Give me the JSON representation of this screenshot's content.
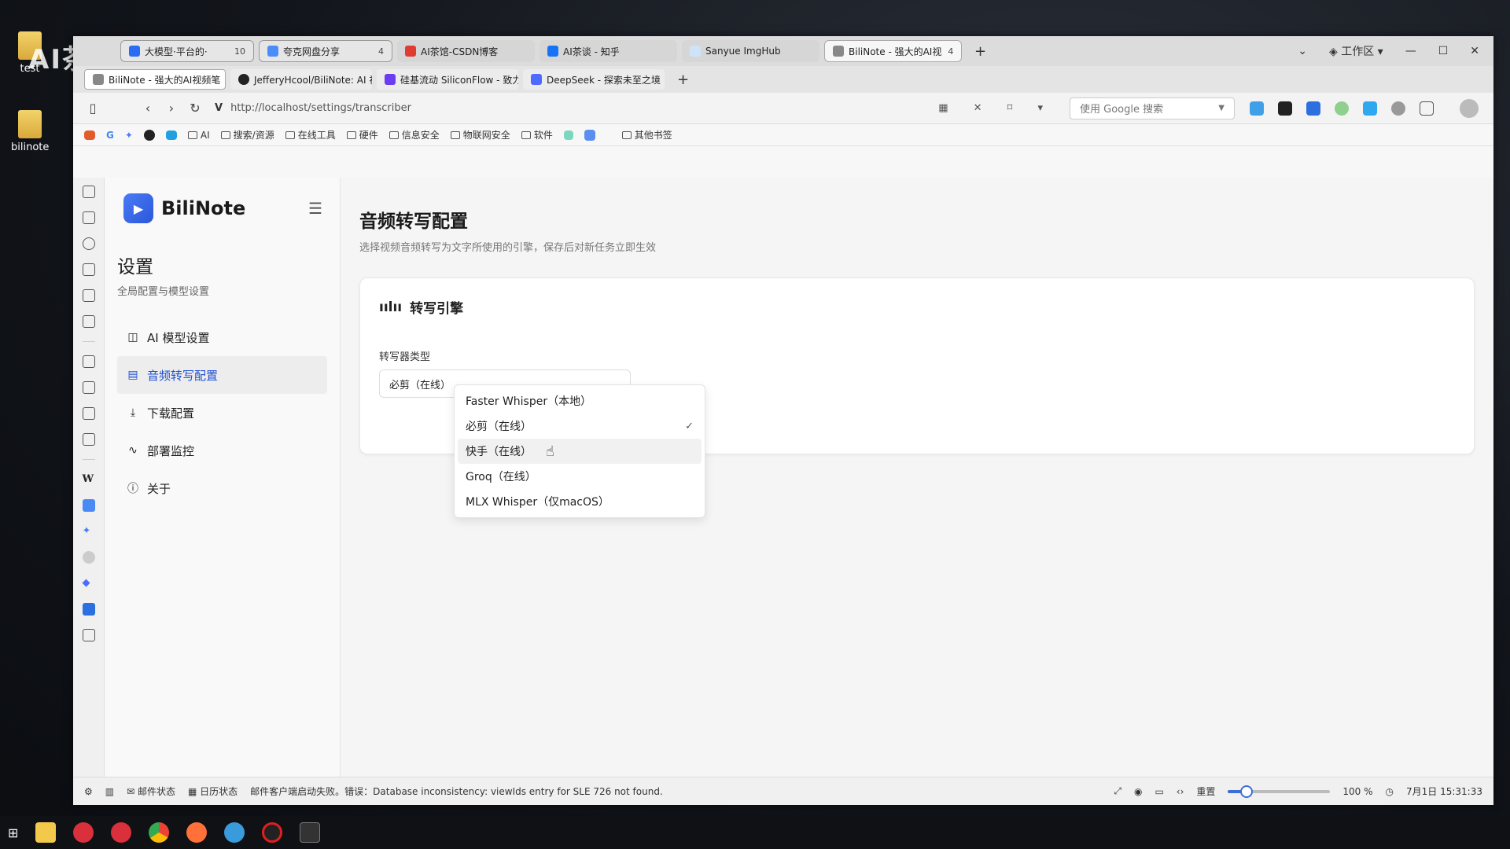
{
  "desktop": {
    "icons": [
      {
        "label": "test"
      },
      {
        "label": "bilinote"
      }
    ],
    "watermark": "AI茶谈"
  },
  "browser": {
    "tabs_row1": [
      {
        "title": "大模型·平台的·",
        "count": "10",
        "color": "#2a6df4"
      },
      {
        "title": "夸克网盘分享",
        "count": "4",
        "color": "#4b8df8"
      },
      {
        "title": "AI茶馆-CSDN博客",
        "count": "",
        "color": "#e03c31"
      },
      {
        "title": "AI茶谈 - 知乎",
        "count": "",
        "color": "#1772f6"
      },
      {
        "title": "Sanyue ImgHub",
        "count": "",
        "color": "#cfe3f7"
      },
      {
        "title": "BiliNote - 强大的AI视",
        "count": "4",
        "color": "#888888"
      }
    ],
    "workspace_label": "工作区",
    "tabs_row2": [
      {
        "title": "BiliNote - 强大的AI视频笔",
        "color": "#888888"
      },
      {
        "title": "JefferyHcool/BiliNote: AI 视",
        "color": "#222222"
      },
      {
        "title": "硅基流动 SiliconFlow - 致力",
        "color": "#6b3cf0"
      },
      {
        "title": "DeepSeek - 探索未至之境",
        "color": "#4d6bfe"
      }
    ],
    "url": "http://localhost/settings/transcriber",
    "search_placeholder": "使用 Google 搜索",
    "bookmarks": [
      "AI",
      "搜索/资源",
      "在线工具",
      "硬件",
      "信息安全",
      "物联网安全",
      "软件",
      "其他书签"
    ]
  },
  "app": {
    "name": "BiliNote",
    "settings_title": "设置",
    "settings_subtitle": "全局配置与模型设置",
    "menu": [
      {
        "label": "AI 模型设置",
        "icon": "bot-icon"
      },
      {
        "label": "音频转写配置",
        "icon": "transcribe-icon"
      },
      {
        "label": "下载配置",
        "icon": "download-icon"
      },
      {
        "label": "部署监控",
        "icon": "activity-icon"
      },
      {
        "label": "关于",
        "icon": "info-icon"
      }
    ],
    "page_title": "音频转写配置",
    "page_subtitle": "选择视频音频转写为文字所使用的引擎，保存后对新任务立即生效",
    "card_title": "转写引擎",
    "field_label": "转写器类型",
    "selected_value": "必剪（在线）",
    "options": [
      {
        "label": "Faster Whisper（本地）"
      },
      {
        "label": "必剪（在线）"
      },
      {
        "label": "快手（在线）"
      },
      {
        "label": "Groq（在线）"
      },
      {
        "label": "MLX Whisper（仅macOS）"
      }
    ]
  },
  "statusbar": {
    "mail": "邮件状态",
    "calendar": "日历状态",
    "message": "邮件客户端启动失败。错误：Database inconsistency: viewIds entry for SLE 726 not found.",
    "reset": "重置",
    "zoom": "100 %",
    "zoom_fraction": 0.18,
    "datetime": "7月1日 15:31:33"
  }
}
